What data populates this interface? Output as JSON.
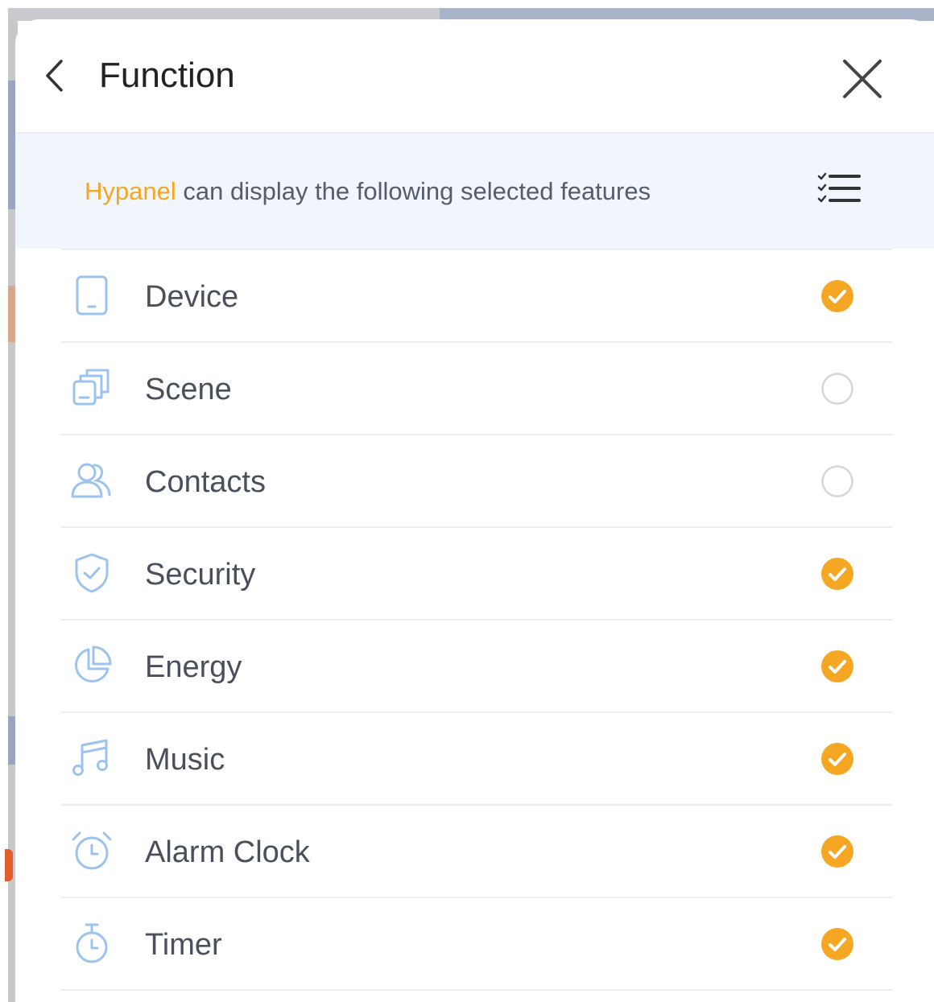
{
  "header": {
    "title": "Function",
    "back_icon": "chevron-left-icon",
    "close_icon": "close-icon"
  },
  "banner": {
    "brand": "Hypanel",
    "text": " can display the following selected features",
    "icon": "checklist-icon"
  },
  "colors": {
    "accent": "#f5a623",
    "icon_blue": "#9cc3f0",
    "banner_bg": "#f1f6fd",
    "label": "#4a4f5c"
  },
  "features": [
    {
      "label": "Device",
      "icon": "device-icon",
      "selected": true
    },
    {
      "label": "Scene",
      "icon": "scene-icon",
      "selected": false
    },
    {
      "label": "Contacts",
      "icon": "contacts-icon",
      "selected": false
    },
    {
      "label": "Security",
      "icon": "shield-icon",
      "selected": true
    },
    {
      "label": "Energy",
      "icon": "pie-chart-icon",
      "selected": true
    },
    {
      "label": "Music",
      "icon": "music-icon",
      "selected": true
    },
    {
      "label": "Alarm Clock",
      "icon": "alarm-clock-icon",
      "selected": true
    },
    {
      "label": "Timer",
      "icon": "stopwatch-icon",
      "selected": true
    }
  ]
}
